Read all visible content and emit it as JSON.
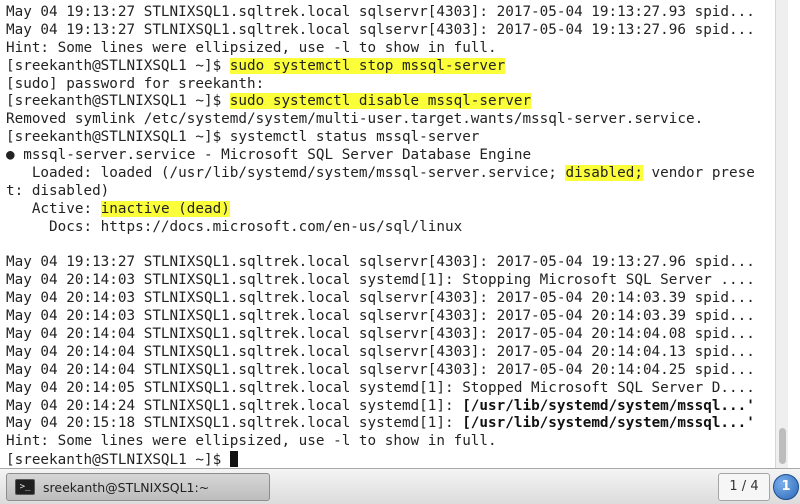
{
  "terminal": {
    "lines": [
      [
        {
          "t": "May 04 19:13:27 STLNIXSQL1.sqltrek.local sqlservr[4303]: 2017-05-04 19:13:27.93 spid..."
        }
      ],
      [
        {
          "t": "May 04 19:13:27 STLNIXSQL1.sqltrek.local sqlservr[4303]: 2017-05-04 19:13:27.96 spid..."
        }
      ],
      [
        {
          "t": "Hint: Some lines were ellipsized, use -l to show in full."
        }
      ],
      [
        {
          "t": "[sreekanth@STLNIXSQL1 ~]$ "
        },
        {
          "t": "sudo systemctl stop mssql-server",
          "hl": true
        }
      ],
      [
        {
          "t": "[sudo] password for sreekanth:"
        }
      ],
      [
        {
          "t": "[sreekanth@STLNIXSQL1 ~]$ "
        },
        {
          "t": "sudo systemctl disable mssql-server",
          "hl": true
        }
      ],
      [
        {
          "t": "Removed symlink /etc/systemd/system/multi-user.target.wants/mssql-server.service."
        }
      ],
      [
        {
          "t": "[sreekanth@STLNIXSQL1 ~]$ systemctl status mssql-server"
        }
      ],
      [
        {
          "t": "● mssql-server.service - Microsoft SQL Server Database Engine"
        }
      ],
      [
        {
          "t": "   Loaded: loaded (/usr/lib/systemd/system/mssql-server.service; "
        },
        {
          "t": "disabled;",
          "hl": true
        },
        {
          "t": " vendor prese"
        }
      ],
      [
        {
          "t": "t: disabled)"
        }
      ],
      [
        {
          "t": "   Active: "
        },
        {
          "t": "inactive (dead)",
          "hl": true
        }
      ],
      [
        {
          "t": "     Docs: https://docs.microsoft.com/en-us/sql/linux"
        }
      ],
      [
        {
          "t": ""
        }
      ],
      [
        {
          "t": "May 04 19:13:27 STLNIXSQL1.sqltrek.local sqlservr[4303]: 2017-05-04 19:13:27.96 spid..."
        }
      ],
      [
        {
          "t": "May 04 20:14:03 STLNIXSQL1.sqltrek.local systemd[1]: Stopping Microsoft SQL Server ...."
        }
      ],
      [
        {
          "t": "May 04 20:14:03 STLNIXSQL1.sqltrek.local sqlservr[4303]: 2017-05-04 20:14:03.39 spid..."
        }
      ],
      [
        {
          "t": "May 04 20:14:03 STLNIXSQL1.sqltrek.local sqlservr[4303]: 2017-05-04 20:14:03.39 spid..."
        }
      ],
      [
        {
          "t": "May 04 20:14:04 STLNIXSQL1.sqltrek.local sqlservr[4303]: 2017-05-04 20:14:04.08 spid..."
        }
      ],
      [
        {
          "t": "May 04 20:14:04 STLNIXSQL1.sqltrek.local sqlservr[4303]: 2017-05-04 20:14:04.13 spid..."
        }
      ],
      [
        {
          "t": "May 04 20:14:04 STLNIXSQL1.sqltrek.local sqlservr[4303]: 2017-05-04 20:14:04.25 spid..."
        }
      ],
      [
        {
          "t": "May 04 20:14:05 STLNIXSQL1.sqltrek.local systemd[1]: Stopped Microsoft SQL Server D...."
        }
      ],
      [
        {
          "t": "May 04 20:14:24 STLNIXSQL1.sqltrek.local systemd[1]: "
        },
        {
          "t": "[/usr/lib/systemd/system/mssql...'",
          "bold": true
        }
      ],
      [
        {
          "t": "May 04 20:15:18 STLNIXSQL1.sqltrek.local systemd[1]: "
        },
        {
          "t": "[/usr/lib/systemd/system/mssql...'",
          "bold": true
        }
      ],
      [
        {
          "t": "Hint: Some lines were ellipsized, use -l to show in full."
        }
      ],
      [
        {
          "t": "[sreekanth@STLNIXSQL1 ~]$ "
        }
      ]
    ],
    "highlight_color": "#fbff3a"
  },
  "taskbar": {
    "window_title": "sreekanth@STLNIXSQL1:~",
    "window_icon": "terminal-icon",
    "workspace_indicator": "1 / 4",
    "notification_count": "1",
    "notification_color": "#2c66b8"
  }
}
